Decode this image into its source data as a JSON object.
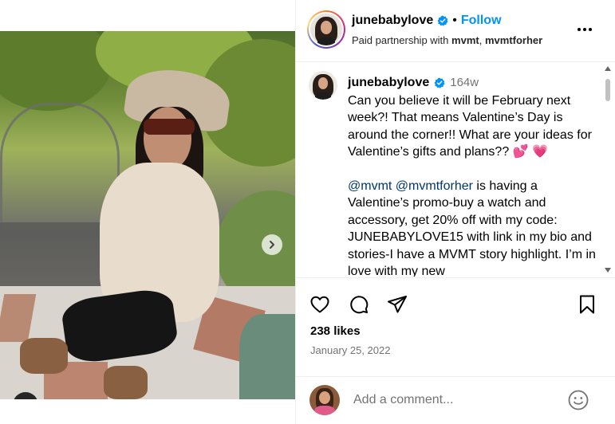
{
  "header": {
    "username": "junebabylove",
    "separator": "•",
    "follow_label": "Follow",
    "partnership_prefix": "Paid partnership with",
    "partner_1": "mvmt",
    "partner_sep": ",",
    "partner_2": "mvmtforher"
  },
  "caption": {
    "username": "junebabylove",
    "time_ago": "164w",
    "paragraph_1": "Can you believe it will be February next week?! That means Valentine’s Day is around the corner!! What are your ideas for Valentine’s gifts and plans??",
    "emoji_1": "💕",
    "emoji_2": "💗",
    "mention_1": "@mvmt",
    "mention_2": "@mvmtforher",
    "paragraph_2": "is having a Valentine’s promo-buy a watch and accessory, get 20% off with my code: JUNEBABYLOVE15 with link in my bio and stories-I have a MVMT story highlight. I’m in love with my new"
  },
  "engagement": {
    "likes": "238 likes",
    "date": "January 25, 2022"
  },
  "comment": {
    "placeholder": "Add a comment..."
  },
  "icons": {
    "like": "heart-icon",
    "comment": "comment-icon",
    "share": "share-icon",
    "save": "bookmark-icon",
    "emoji": "emoji-icon",
    "verified": "verified-badge-icon",
    "more": "more-options-icon",
    "next": "chevron-right-icon",
    "tag": "user-tag-icon"
  },
  "colors": {
    "follow": "#0095f6",
    "verified": "#0095f6",
    "mention": "#00376b",
    "secondary_text": "#737373"
  }
}
